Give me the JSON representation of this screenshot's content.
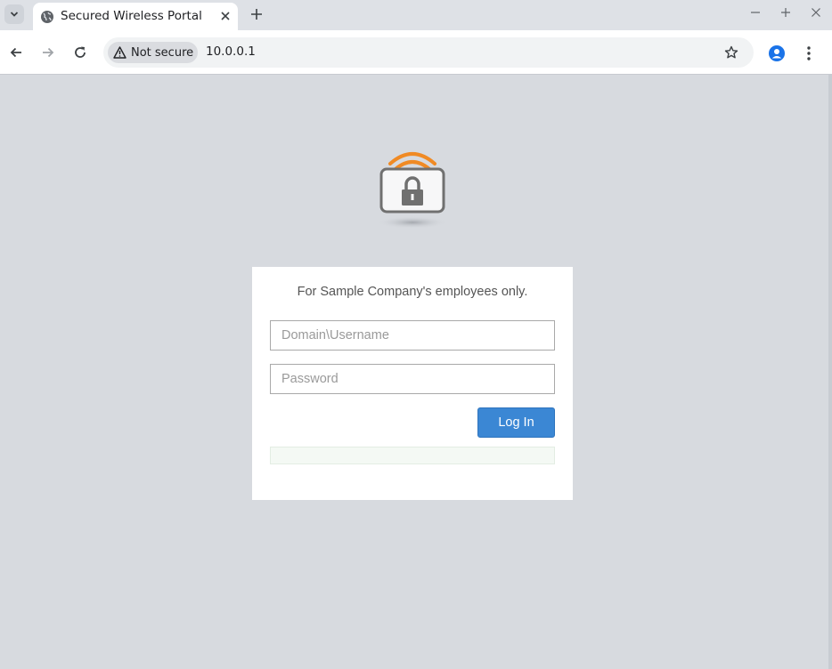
{
  "browser": {
    "tab_title": "Secured Wireless Portal",
    "security_label": "Not secure",
    "url": "10.0.0.1"
  },
  "portal": {
    "notice": "For Sample Company's employees only.",
    "username_placeholder": "Domain\\Username",
    "password_placeholder": "Password",
    "login_label": "Log In",
    "accent_color": "#3b87d4",
    "logo_wave_color": "#f08a24"
  }
}
